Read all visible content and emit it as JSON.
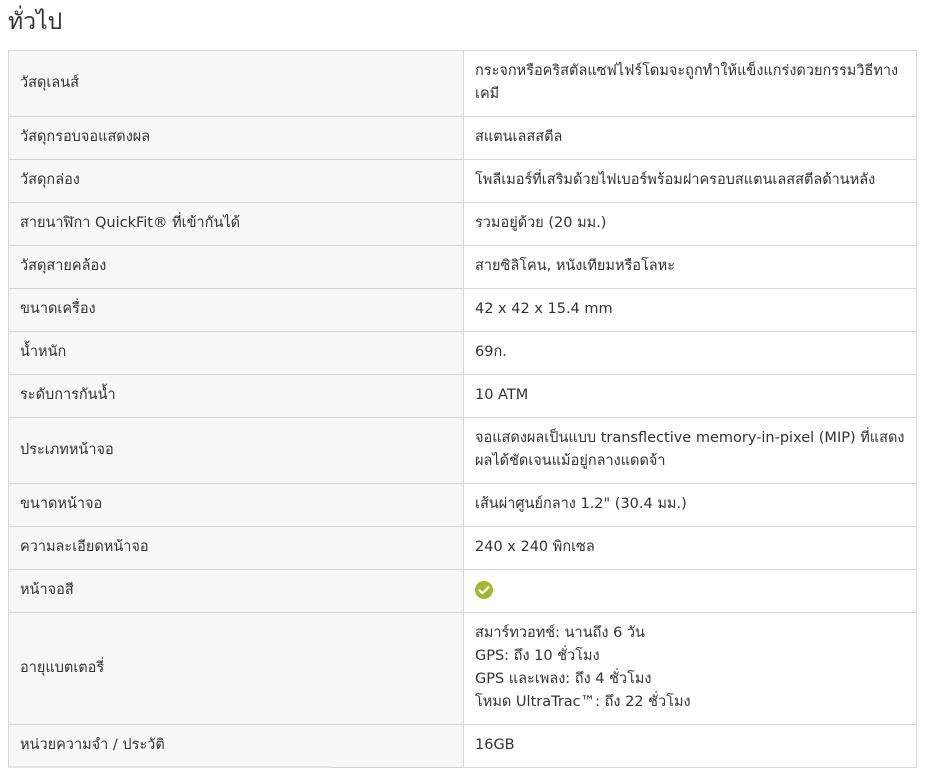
{
  "section": {
    "title": "ทั่วไป"
  },
  "rows": [
    {
      "label": "วัสดุเลนส์",
      "value": "กระจกหรือคริสตัลแซฟไฟร์โดมจะถูกทำให้แข็งแกร่งดวยกรรมวิธีทางเคมี"
    },
    {
      "label": "วัสดุกรอบจอแสดงผล",
      "value": "สแตนเลสสตีล"
    },
    {
      "label": "วัสดุกล่อง",
      "value": "โพลีเมอร์ที่เสริมด้วยไฟเบอร์พร้อมฝาครอบสแตนเลสสตีลด้านหลัง"
    },
    {
      "label": "สายนาฬิกา QuickFit® ที่เข้ากันได้",
      "value": "รวมอยู่ด้วย (20 มม.)"
    },
    {
      "label": "วัสดุสายคล้อง",
      "value": "สายซิลิโคน, หนังเทียมหรือโลหะ"
    },
    {
      "label": "ขนาดเครื่อง",
      "value": "42 x 42 x 15.4 mm"
    },
    {
      "label": "น้ำหนัก",
      "value": "69ก."
    },
    {
      "label": "ระดับการกันน้ำ",
      "value": "10 ATM"
    },
    {
      "label": "ประเภทหน้าจอ",
      "value": "จอแสดงผลเป็นแบบ transflective memory-in-pixel (MIP) ที่แสดงผลได้ชัดเจนแม้อยู่กลางแดดจ้า"
    },
    {
      "label": "ขนาดหน้าจอ",
      "value": "เส้นผ่าศูนย์กลาง 1.2\" (30.4 มม.)"
    },
    {
      "label": "ความละเอียดหน้าจอ",
      "value": "240 x 240  พิกเซล"
    },
    {
      "label": "หน้าจอสี",
      "icon": "check-circle-icon",
      "accent": "#a2b72c"
    },
    {
      "label": "อายุแบตเตอรี่",
      "lines": [
        "สมาร์ทวอทช์: นานถึง 6 วัน",
        "GPS: ถึง 10 ชั่วโมง",
        "GPS และเพลง: ถึง 4 ชั่วโมง",
        "โหมด UltraTrac™: ถึง 22 ชั่วโมง"
      ]
    },
    {
      "label": "หน่วยความจำ / ประวัติ",
      "value": "16GB"
    }
  ]
}
